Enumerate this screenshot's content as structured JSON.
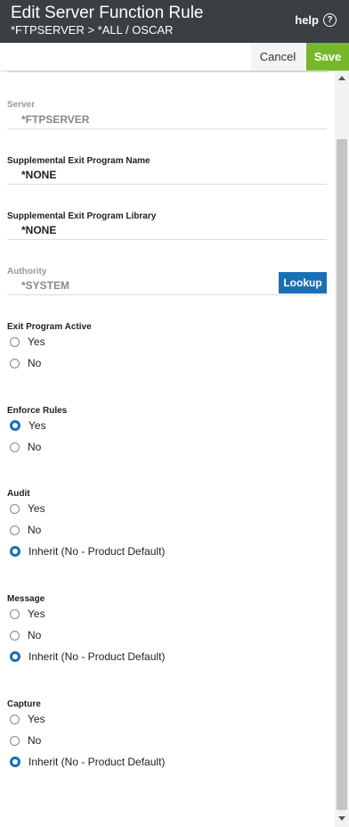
{
  "header": {
    "title": "Edit Server Function Rule",
    "breadcrumb": "*FTPSERVER > *ALL / OSCAR",
    "help_label": "help",
    "help_icon": "?"
  },
  "toolbar": {
    "cancel_label": "Cancel",
    "save_label": "Save"
  },
  "fields": {
    "server": {
      "label": "Server",
      "value": "*FTPSERVER"
    },
    "exit_program_name": {
      "label": "Supplemental Exit Program Name",
      "value": "*NONE"
    },
    "exit_program_library": {
      "label": "Supplemental Exit Program Library",
      "value": "*NONE"
    },
    "authority": {
      "label": "Authority",
      "value": "*SYSTEM",
      "lookup_label": "Lookup"
    }
  },
  "groups": {
    "exit_program_active": {
      "label": "Exit Program Active",
      "options": [
        "Yes",
        "No"
      ],
      "selected": null
    },
    "enforce_rules": {
      "label": "Enforce Rules",
      "options": [
        "Yes",
        "No"
      ],
      "selected": "Yes"
    },
    "audit": {
      "label": "Audit",
      "options": [
        "Yes",
        "No",
        "Inherit (No - Product Default)"
      ],
      "selected": "Inherit (No - Product Default)"
    },
    "message": {
      "label": "Message",
      "options": [
        "Yes",
        "No",
        "Inherit (No - Product Default)"
      ],
      "selected": "Inherit (No - Product Default)"
    },
    "capture": {
      "label": "Capture",
      "options": [
        "Yes",
        "No",
        "Inherit (No - Product Default)"
      ],
      "selected": "Inherit (No - Product Default)"
    }
  },
  "colors": {
    "header_bg": "#3a3f44",
    "save_green": "#77b82a",
    "accent_blue": "#1a6fb5"
  }
}
